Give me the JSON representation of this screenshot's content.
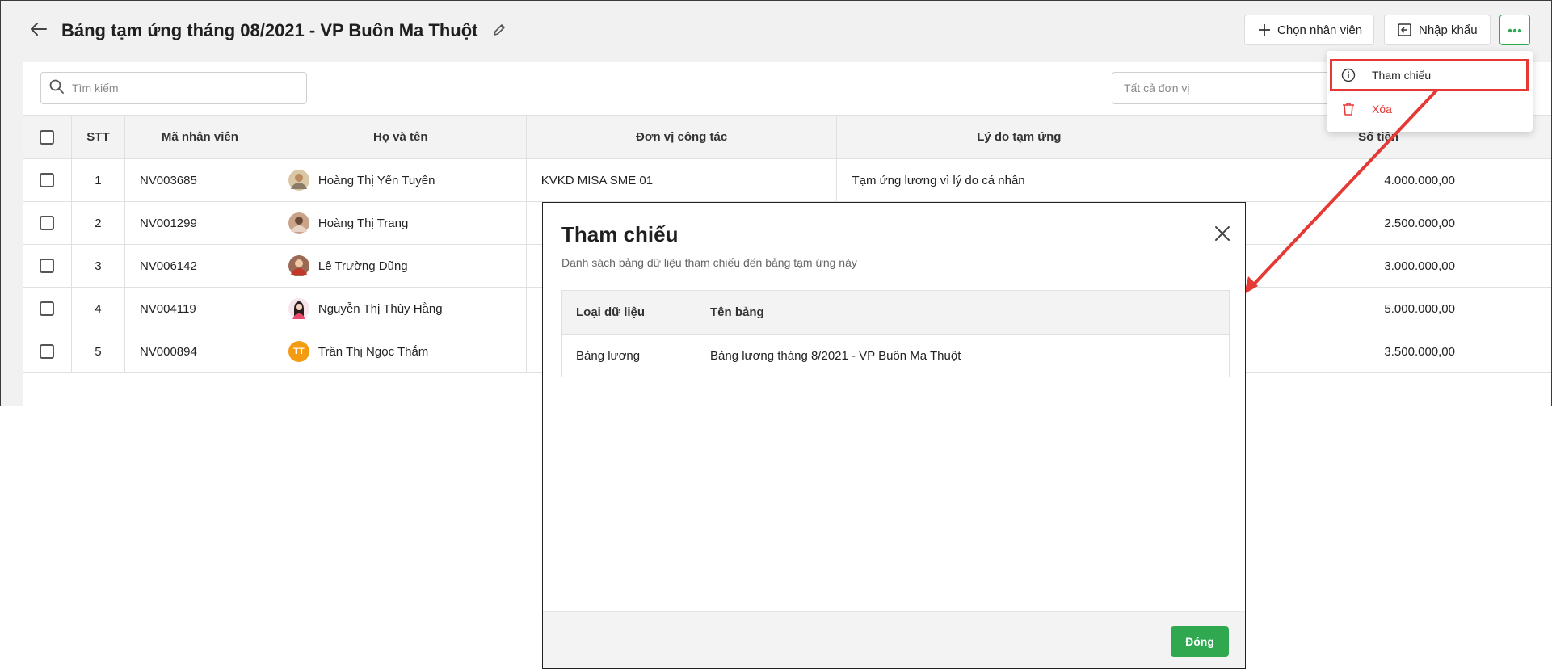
{
  "header": {
    "title": "Bảng tạm ứng tháng 08/2021 - VP Buôn Ma Thuột",
    "choose_employee_label": "Chọn nhân viên",
    "import_label": "Nhập khẩu"
  },
  "toolbar": {
    "search_placeholder": "Tìm kiếm",
    "unit_filter": "Tất cả đơn vị"
  },
  "menu": {
    "items": [
      {
        "label": "Tham chiếu"
      },
      {
        "label": "Xóa"
      }
    ]
  },
  "table": {
    "columns": [
      "STT",
      "Mã nhân viên",
      "Họ và tên",
      "Đơn vị công tác",
      "Lý do tạm ứng",
      "Số tiền"
    ],
    "rows": [
      {
        "stt": "1",
        "code": "NV003685",
        "name": "Hoàng Thị Yến Tuyên",
        "unit": "KVKD MISA SME 01",
        "reason": "Tạm ứng lương vì lý do cá nhân",
        "amount": "4.000.000,00",
        "avatar": "photo"
      },
      {
        "stt": "2",
        "code": "NV001299",
        "name": "Hoàng Thị Trang",
        "unit": "",
        "reason": "",
        "amount": "2.500.000,00",
        "avatar": "photo"
      },
      {
        "stt": "3",
        "code": "NV006142",
        "name": "Lê Trường Dũng",
        "unit": "",
        "reason": "",
        "amount": "3.000.000,00",
        "avatar": "photo"
      },
      {
        "stt": "4",
        "code": "NV004119",
        "name": "Nguyễn Thị Thùy Hằng",
        "unit": "",
        "reason": "",
        "amount": "5.000.000,00",
        "avatar": "photo"
      },
      {
        "stt": "5",
        "code": "NV000894",
        "name": "Trần Thị Ngọc Thắm",
        "unit": "",
        "reason": "",
        "amount": "3.500.000,00",
        "avatar": "TT"
      }
    ]
  },
  "modal": {
    "title": "Tham chiếu",
    "subtitle": "Danh sách bảng dữ liệu tham chiếu đến bảng tạm ứng này",
    "columns": [
      "Loại dữ liệu",
      "Tên bảng"
    ],
    "rows": [
      {
        "type": "Bảng lương",
        "name": "Bảng lương tháng 8/2021 - VP Buôn Ma Thuột"
      }
    ],
    "close_label": "Đóng"
  },
  "colors": {
    "accent": "#2fa84f",
    "danger": "#e53935",
    "avatar_initials_bg": "#f39c12"
  }
}
